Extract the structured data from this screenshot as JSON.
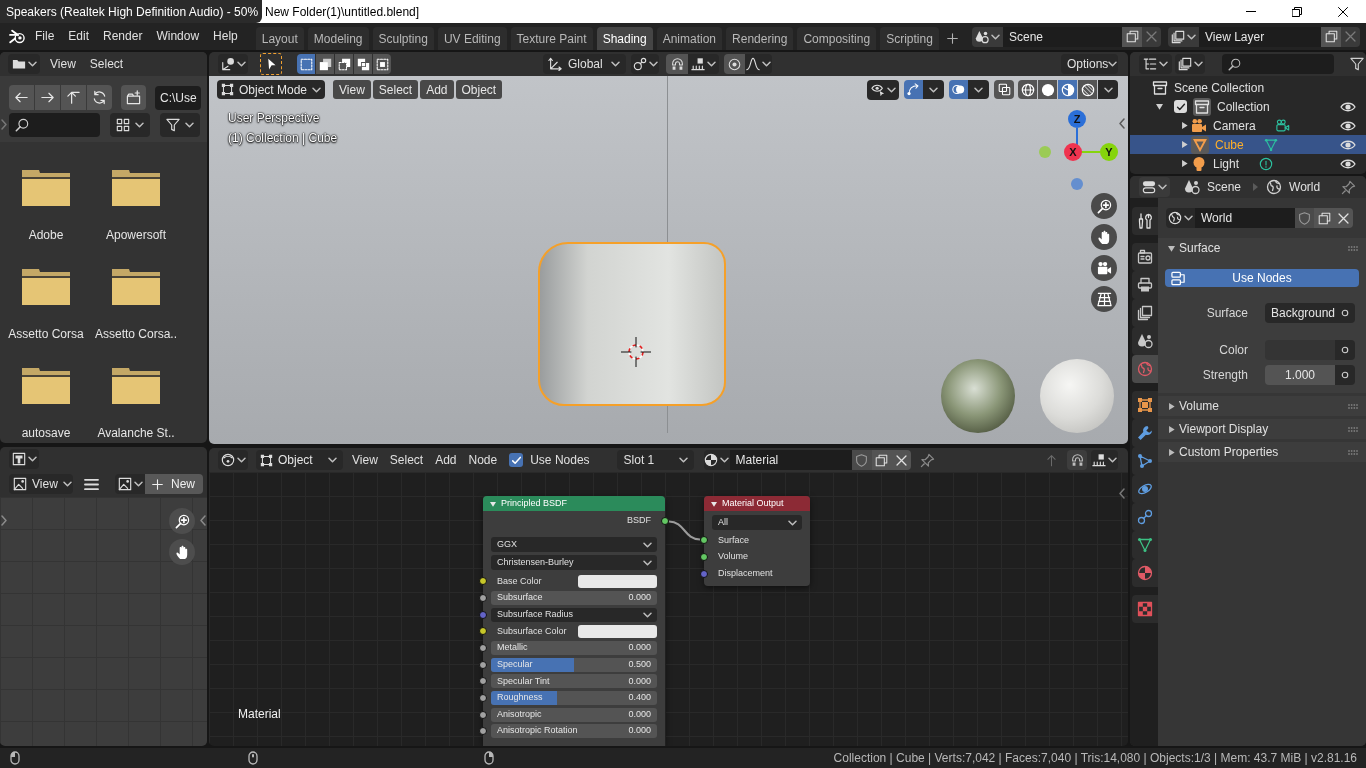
{
  "title_bar": {
    "tooltip": "Speakers (Realtek High Definition Audio) - 50%",
    "title": "New Folder(1)\\untitled.blend]"
  },
  "top_bar": {
    "menus": [
      "File",
      "Edit",
      "Render",
      "Window",
      "Help"
    ],
    "workspaces": [
      {
        "label": "Layout",
        "selected": false
      },
      {
        "label": "Modeling",
        "selected": false
      },
      {
        "label": "Sculpting",
        "selected": false
      },
      {
        "label": "UV Editing",
        "selected": false
      },
      {
        "label": "Texture Paint",
        "selected": false
      },
      {
        "label": "Shading",
        "selected": true
      },
      {
        "label": "Animation",
        "selected": false
      },
      {
        "label": "Rendering",
        "selected": false
      },
      {
        "label": "Compositing",
        "selected": false
      },
      {
        "label": "Scripting",
        "selected": false
      }
    ],
    "scene": "Scene",
    "view_layer": "View Layer"
  },
  "file_browser": {
    "menus": [
      "View",
      "Select"
    ],
    "path": "C:\\Use",
    "folders": [
      "Adobe",
      "Apowersoft",
      "Assetto Corsa",
      "Assetto Corsa..",
      "autosave",
      "Avalanche St.."
    ]
  },
  "image_editor": {
    "view_menu": "View",
    "new_button": "New"
  },
  "viewport": {
    "orientation": "Global",
    "options": "Options",
    "selection_modes": [
      {
        "kind": "set",
        "selected": true
      },
      {
        "kind": "extend",
        "selected": false
      },
      {
        "kind": "subtract",
        "selected": false
      },
      {
        "kind": "difference",
        "selected": false
      },
      {
        "kind": "intersect",
        "selected": false
      }
    ],
    "mode": "Object Mode",
    "menus": [
      "View",
      "Select",
      "Add",
      "Object"
    ],
    "toggles": [
      {
        "kind": "gizmo",
        "on": true
      },
      {
        "kind": "overlay",
        "on": true
      },
      {
        "kind": "xray",
        "on": false
      }
    ],
    "shading_modes": [
      {
        "kind": "wireframe",
        "selected": false
      },
      {
        "kind": "solid",
        "selected": false
      },
      {
        "kind": "material",
        "selected": true
      },
      {
        "kind": "rendered",
        "selected": false
      }
    ],
    "view_name": "User Perspective",
    "context": "(1) Collection | Cube",
    "axes": [
      {
        "label": "Z",
        "color": "#2b6fd8"
      },
      {
        "label": "X",
        "color": "#f0334f"
      },
      {
        "label": "Y",
        "color": "#86d40c"
      }
    ]
  },
  "node_editor": {
    "object_type": "Object",
    "menus": [
      "View",
      "Select",
      "Add",
      "Node"
    ],
    "use_nodes": {
      "label": "Use Nodes",
      "checked": true
    },
    "slot": "Slot 1",
    "material": "Material",
    "tree_name": "Material",
    "nodes": [
      {
        "kind": "shader",
        "title": "Principled BSDF",
        "color": "#2b8b5b",
        "outputs": [
          "BSDF"
        ],
        "dropdowns": [
          "GGX",
          "Christensen-Burley"
        ],
        "inputs": [
          {
            "kind": "color",
            "label": "Base Color",
            "color": "#e8e8e8"
          },
          {
            "kind": "value",
            "label": "Subsurface",
            "value": "0.000",
            "level": 0
          },
          {
            "kind": "menu",
            "label": "Subsurface Radius"
          },
          {
            "kind": "color",
            "label": "Subsurface Color",
            "color": "#e8e8e8"
          },
          {
            "kind": "value",
            "label": "Metallic",
            "value": "0.000",
            "level": 0
          },
          {
            "kind": "value",
            "label": "Specular",
            "value": "0.500",
            "level": 0.5
          },
          {
            "kind": "value",
            "label": "Specular Tint",
            "value": "0.000",
            "level": 0
          },
          {
            "kind": "value",
            "label": "Roughness",
            "value": "0.400",
            "level": 0.4
          },
          {
            "kind": "value",
            "label": "Anisotropic",
            "value": "0.000",
            "level": 0
          },
          {
            "kind": "value",
            "label": "Anisotropic Rotation",
            "value": "0.000",
            "level": 0
          }
        ]
      },
      {
        "kind": "output",
        "title": "Material Output",
        "color": "#8c2a35",
        "dropdowns": [
          "All"
        ],
        "inputs": [
          {
            "kind": "shader",
            "label": "Surface"
          },
          {
            "kind": "shader",
            "label": "Volume"
          },
          {
            "kind": "vector",
            "label": "Displacement"
          }
        ]
      }
    ]
  },
  "outliner": {
    "tree": [
      {
        "kind": "scene_collection",
        "label": "Scene Collection",
        "selected": false,
        "active": false,
        "children": [
          {
            "kind": "collection",
            "label": "Collection",
            "expanded": true,
            "checked": true,
            "visible": true,
            "selected": false,
            "active": true,
            "children": [
              {
                "kind": "camera",
                "label": "Camera",
                "expanded": false,
                "visible": true,
                "selected": false,
                "active": false
              },
              {
                "kind": "mesh",
                "label": "Cube",
                "expanded": false,
                "visible": true,
                "selected": true,
                "active": true
              },
              {
                "kind": "light",
                "label": "Light",
                "expanded": false,
                "visible": true,
                "selected": false,
                "active": false
              }
            ]
          }
        ]
      }
    ]
  },
  "properties": {
    "breadcrumb": [
      "Scene",
      "World"
    ],
    "tabs": [
      {
        "kind": "tool",
        "selected": false
      },
      {
        "kind": "render",
        "selected": false
      },
      {
        "kind": "output",
        "selected": false
      },
      {
        "kind": "view_layer",
        "selected": false
      },
      {
        "kind": "scene",
        "selected": false
      },
      {
        "kind": "world",
        "selected": true
      },
      {
        "kind": "object",
        "selected": false
      },
      {
        "kind": "modifiers",
        "selected": false
      },
      {
        "kind": "particles",
        "selected": false
      },
      {
        "kind": "physics",
        "selected": false
      },
      {
        "kind": "constraints",
        "selected": false
      },
      {
        "kind": "data",
        "selected": false
      },
      {
        "kind": "material",
        "selected": false
      },
      {
        "kind": "texture",
        "selected": false
      }
    ],
    "world": "World",
    "panels": [
      {
        "title": "Surface",
        "expanded": true,
        "button": "Use Nodes",
        "fields": [
          {
            "kind": "dropdown",
            "label": "Surface",
            "value": "Background"
          },
          {
            "kind": "color",
            "label": "Color",
            "color": "#343434"
          },
          {
            "kind": "value",
            "label": "Strength",
            "value": "1.000"
          }
        ]
      },
      {
        "title": "Volume",
        "expanded": false
      },
      {
        "title": "Viewport Display",
        "expanded": false
      },
      {
        "title": "Custom Properties",
        "expanded": false
      }
    ]
  },
  "status_bar": {
    "stats": "Collection | Cube | Verts:7,042 | Faces:7,040 | Tris:14,080 | Objects:1/3 | Mem: 43.7 MiB | v2.81.16"
  }
}
